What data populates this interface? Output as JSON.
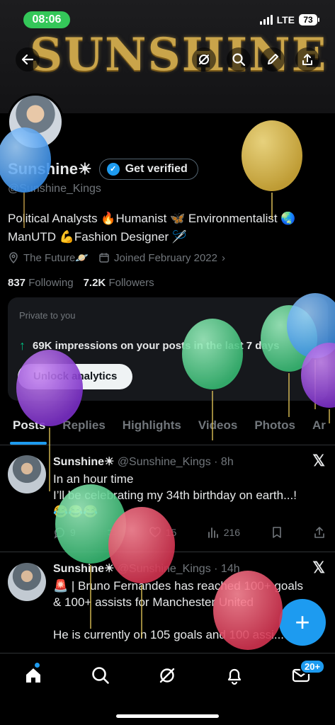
{
  "status_bar": {
    "time": "08:06",
    "network": "LTE",
    "battery": "73"
  },
  "banner": {
    "text": "SUNSHINE"
  },
  "profile": {
    "name": "Sunshine☀",
    "verify_label": "Get verified",
    "handle": "@Sunshine_Kings",
    "bio_line1": "Political Analysts 🔥Humanist 🦋 Environmentalist 🌏",
    "bio_line2": "ManUTD 💪Fashion Designer 🪡",
    "location": "The Future🪐",
    "joined": "Joined February 2022",
    "following_count": "837",
    "following_label": "Following",
    "followers_count": "7.2K",
    "followers_label": "Followers"
  },
  "private_card": {
    "title": "Private to you",
    "impressions": "69K impressions on your posts in the last 7 days",
    "unlock_label": "Unlock analytics"
  },
  "tabs": [
    "Posts",
    "Replies",
    "Highlights",
    "Videos",
    "Photos",
    "Ar"
  ],
  "posts": [
    {
      "name": "Sunshine☀",
      "meta": "@Sunshine_Kings · 8h",
      "text": "In an hour time\nI’ll be celebrating my 34th birthday on earth...!\n😂😂😂",
      "replies": "9",
      "likes": "15",
      "views": "216"
    },
    {
      "name": "Sunshine☀",
      "meta": "@Sunshine_Kings · 14h",
      "text": "🚨 | Bruno Fernandes has reached 100+ goals\n& 100+ assists for Manchester United\n\nHe is currently on 105 goals and 100 assi..."
    }
  ],
  "nav": {
    "messages_badge": "20+"
  },
  "colors": {
    "accent": "#1d9bf0",
    "status_green": "#34c759",
    "banner_gold": "#c9a44a"
  }
}
